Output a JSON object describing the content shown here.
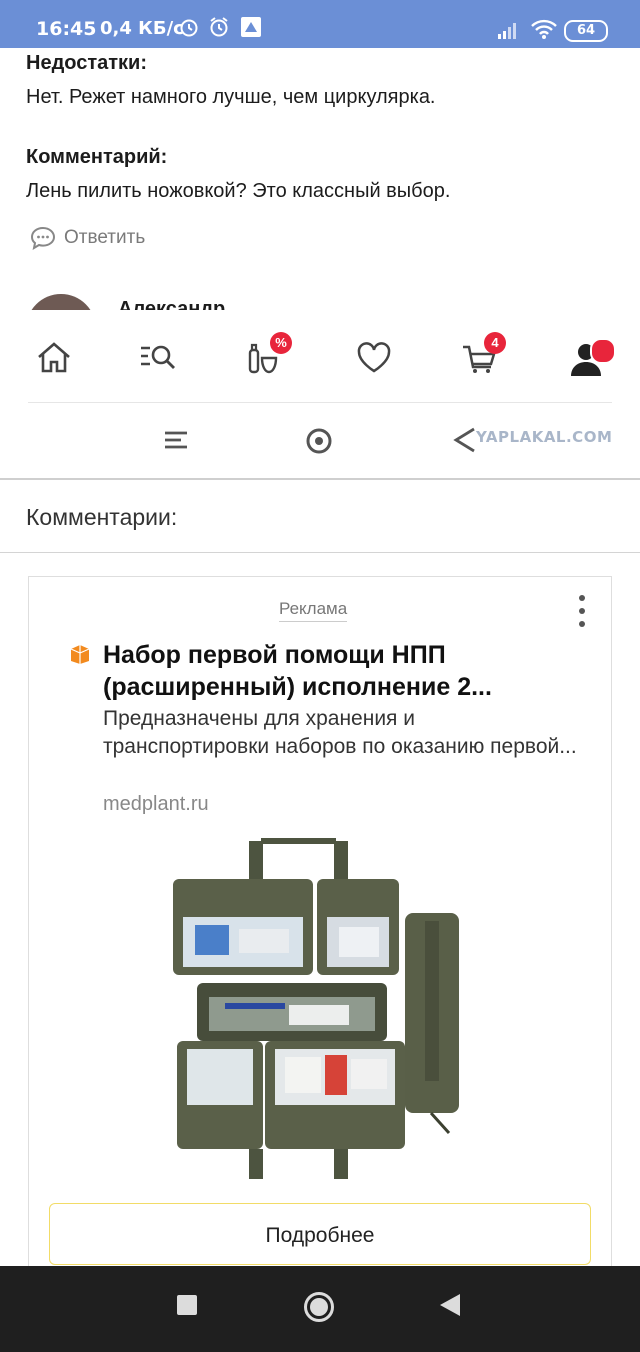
{
  "status_bar": {
    "time": "16:45",
    "net_speed": "0,4 КБ/с",
    "battery": "64"
  },
  "review": {
    "cons_label": "Недостатки:",
    "cons_text": "Нет. Режет намного лучше, чем циркулярка.",
    "comment_label": "Комментарий:",
    "comment_text": "Лень пилить ножовкой? Это классный выбор.",
    "reply_label": "Ответить",
    "next_author_partial": "Александр"
  },
  "bottom_nav": {
    "items": [
      {
        "icon": "home-icon"
      },
      {
        "icon": "catalog-search-icon"
      },
      {
        "icon": "discount-goods-icon",
        "badge": "%"
      },
      {
        "icon": "favorites-heart-icon"
      },
      {
        "icon": "cart-icon",
        "badge": "4"
      },
      {
        "icon": "profile-icon"
      }
    ]
  },
  "watermark": "YAPLAKAL.COM",
  "comments_heading": "Комментарии:",
  "ad": {
    "label": "Реклама",
    "title": "Набор первой помощи НПП (расширенный) исполнение 2...",
    "description": "Предназначены для хранения и транспортировки наборов по оказанию первой...",
    "domain": "medplant.ru",
    "button_label": "Подробнее"
  },
  "colors": {
    "status_bar": "#6b8fd6",
    "badge_red": "#e8253b",
    "button_border": "#f2dc67",
    "system_nav": "#1f1f1f"
  }
}
